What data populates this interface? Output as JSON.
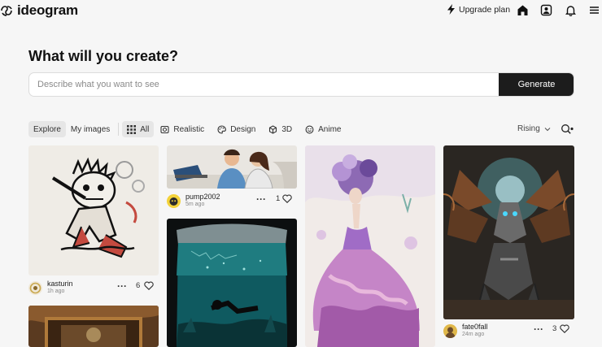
{
  "app": {
    "name": "ideogram"
  },
  "header": {
    "upgrade_label": "Upgrade plan",
    "icons": [
      "home-icon",
      "gallery-icon",
      "bell-icon",
      "menu-icon"
    ]
  },
  "hero": {
    "title": "What will you create?",
    "prompt_placeholder": "Describe what you want to see",
    "generate_label": "Generate"
  },
  "filters": {
    "view_tabs": [
      {
        "label": "Explore",
        "active": true
      },
      {
        "label": "My images",
        "active": false
      }
    ],
    "categories": [
      {
        "label": "All",
        "icon": "grid-icon",
        "active": true
      },
      {
        "label": "Realistic",
        "icon": "camera-icon",
        "active": false
      },
      {
        "label": "Design",
        "icon": "palette-icon",
        "active": false
      },
      {
        "label": "3D",
        "icon": "cube-icon",
        "active": false
      },
      {
        "label": "Anime",
        "icon": "smile-icon",
        "active": false
      }
    ],
    "sort_label": "Rising"
  },
  "feed": [
    {
      "user": "kasturin",
      "time": "1h ago",
      "likes": "6",
      "image": "tribal-flute-player-illustration"
    },
    {
      "user": "pump2002",
      "time": "5m ago",
      "likes": "1",
      "image": "people-at-laptop-illustration"
    },
    {
      "user": "",
      "time": "",
      "likes": "",
      "image": "underwater-diver-bag"
    },
    {
      "user": "",
      "time": "",
      "likes": "",
      "image": "flower-dress-woman-watercolor"
    },
    {
      "user": "fate0fall",
      "time": "24m ago",
      "likes": "3",
      "image": "mechanical-dragon"
    },
    {
      "user": "",
      "time": "",
      "likes": "",
      "image": "ornate-frame-painting"
    }
  ],
  "colors": {
    "accent": "#1c1c1c",
    "background": "#f6f6f6"
  }
}
